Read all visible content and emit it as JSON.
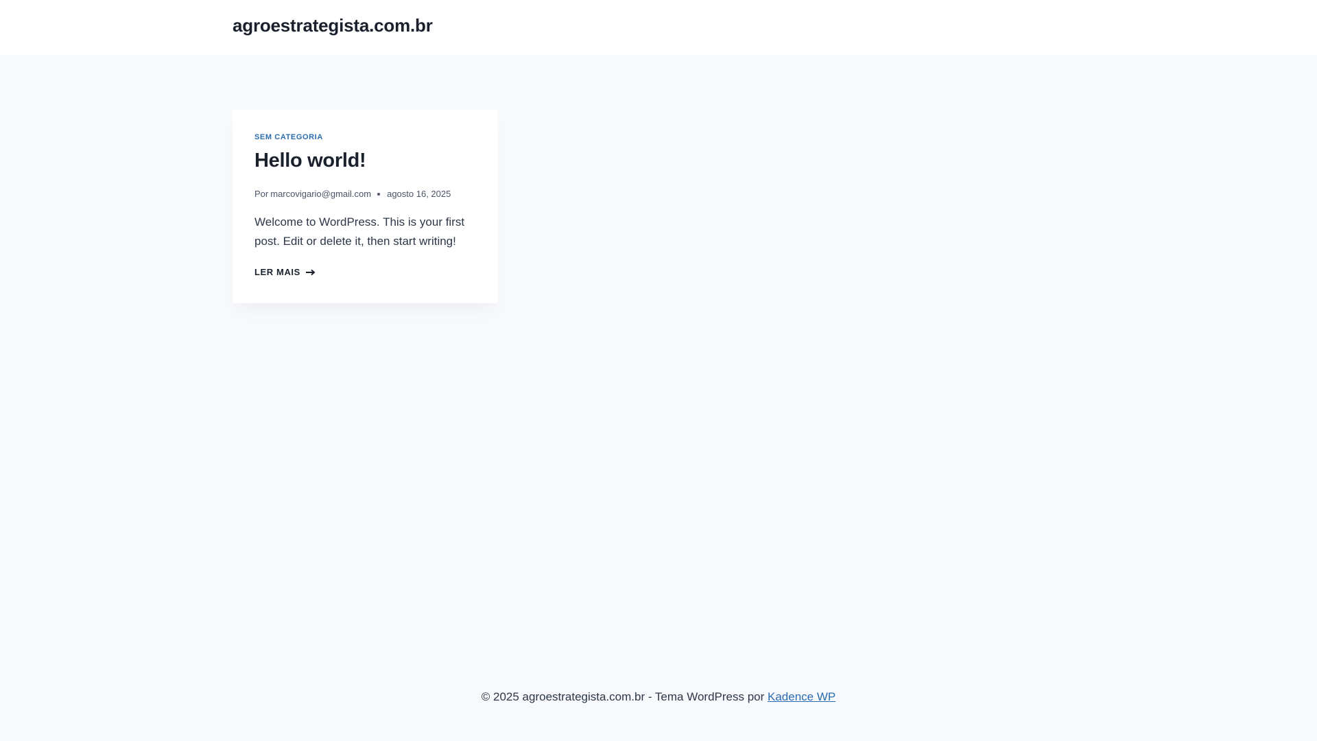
{
  "header": {
    "site_title": "agroestrategista.com.br"
  },
  "post": {
    "category": "SEM CATEGORIA",
    "title": "Hello world!",
    "meta_prefix": "Por",
    "author": "marcovigario@gmail.com",
    "date": "agosto 16, 2025",
    "excerpt": "Welcome to WordPress. This is your first post. Edit or delete it, then start writing!",
    "read_more": "LER MAIS",
    "read_more_icon": "arrow-right-icon"
  },
  "footer": {
    "copyright": "© 2025 agroestrategista.com.br - Tema WordPress por",
    "theme_link": "Kadence WP"
  },
  "colors": {
    "background": "#f7f9fc",
    "card": "#ffffff",
    "accent": "#2b6cb0",
    "heading": "#1a202c",
    "text": "#2d3748"
  }
}
